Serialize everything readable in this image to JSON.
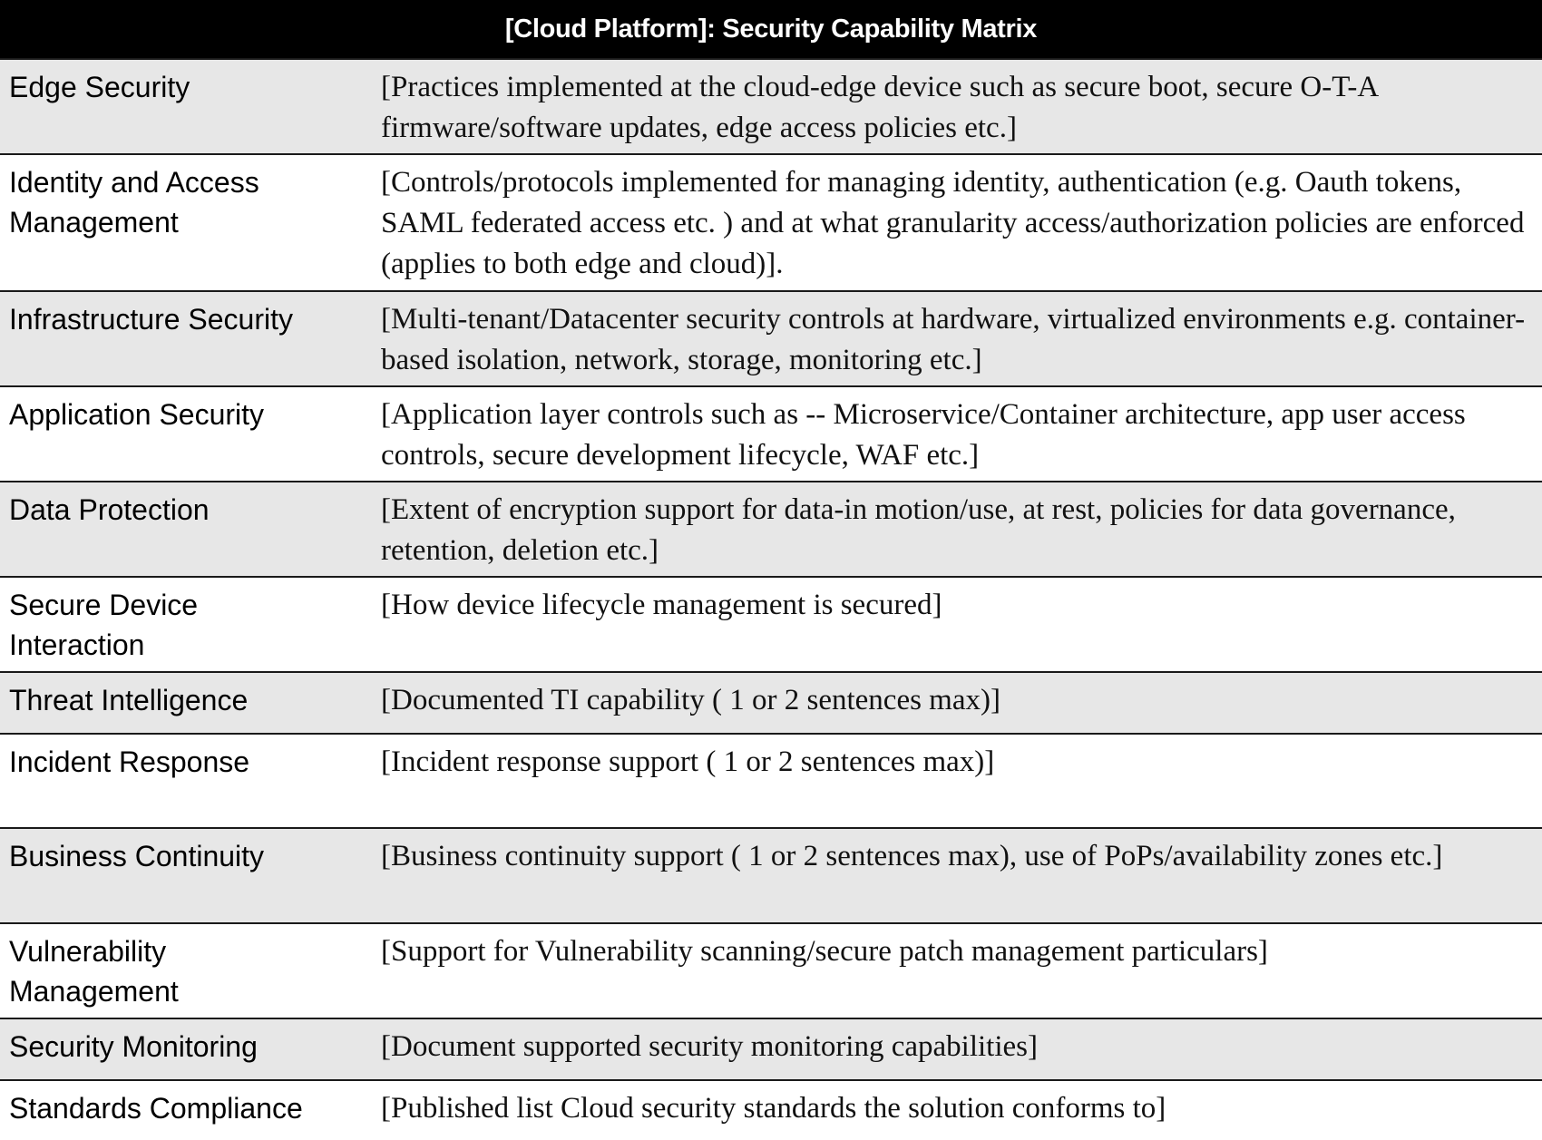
{
  "header": {
    "title": "[Cloud Platform]: Security Capability Matrix"
  },
  "rows": [
    {
      "label": "Edge Security",
      "description": "[Practices implemented at the cloud-edge device such as secure boot, secure O-T-A firmware/software updates, edge access policies etc.]",
      "shaded": true
    },
    {
      "label": "Identity and Access Management",
      "description": "[Controls/protocols implemented for managing identity, authentication (e.g. Oauth  tokens, SAML federated access etc. ) and at what granularity access/authorization policies are enforced (applies to both edge and cloud)].",
      "shaded": false
    },
    {
      "label": "Infrastructure Security",
      "description": "[Multi-tenant/Datacenter security controls at hardware, virtualized environments e.g. container-based isolation, network, storage, monitoring etc.]",
      "shaded": true
    },
    {
      "label": "Application Security",
      "description": "[Application layer controls such as -- Microservice/Container architecture, app user access controls, secure development lifecycle, WAF etc.]",
      "shaded": false
    },
    {
      "label": "Data Protection",
      "description": "[Extent of encryption support for data-in motion/use, at rest, policies for data governance, retention, deletion etc.]",
      "shaded": true
    },
    {
      "label": "Secure Device Interaction",
      "description": "[How device lifecycle management is secured]",
      "shaded": false
    },
    {
      "label": "Threat Intelligence",
      "description": "[Documented TI capability ( 1 or 2 sentences max)]",
      "shaded": true
    },
    {
      "label": "Incident Response",
      "description": "[Incident response support ( 1 or 2 sentences max)]",
      "shaded": false
    },
    {
      "label": "Business Continuity",
      "description": "[Business continuity support ( 1 or 2 sentences max), use of PoPs/availability zones etc.]",
      "shaded": true
    },
    {
      "label": "Vulnerability Management",
      "description": "[Support for Vulnerability scanning/secure patch management particulars]",
      "shaded": false
    },
    {
      "label": "Security Monitoring",
      "description": "[Document supported security monitoring capabilities]",
      "shaded": true
    },
    {
      "label": "Standards Compliance",
      "description": "[Published list Cloud security standards the solution conforms to]",
      "shaded": false
    }
  ]
}
